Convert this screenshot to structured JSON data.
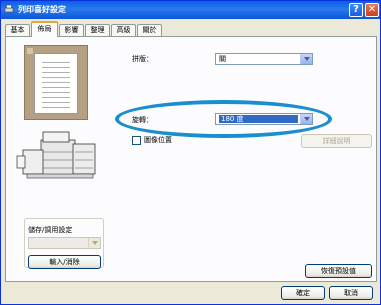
{
  "window": {
    "title": "列印喜好設定",
    "help_label": "?",
    "close_label": "✕"
  },
  "tabs": [
    {
      "label": "基本",
      "active": false
    },
    {
      "label": "佈局",
      "active": true
    },
    {
      "label": "影響",
      "active": false
    },
    {
      "label": "整理",
      "active": false
    },
    {
      "label": "高級",
      "active": false
    },
    {
      "label": "關於",
      "active": false
    }
  ],
  "layout": {
    "pages_per_sheet": {
      "label": "拼版：",
      "value": "關"
    },
    "rotation": {
      "label": "旋轉：",
      "value": "180 度"
    },
    "mirror_image": {
      "label": "圖像位置",
      "checked": false
    },
    "details_button": "詳細說明"
  },
  "presets": {
    "group_label": "儲存/調用設定",
    "select_value": "",
    "load_button": "輸入/消除"
  },
  "footer": {
    "restore_defaults_button": "恢復預設值",
    "ok_button": "確定",
    "cancel_button": "取消"
  },
  "colors": {
    "title_bar": "#0a5ee6",
    "highlight": "#316ac5",
    "annotation_ellipse": "#1a8fd0",
    "preview_background": "#b5a083"
  }
}
